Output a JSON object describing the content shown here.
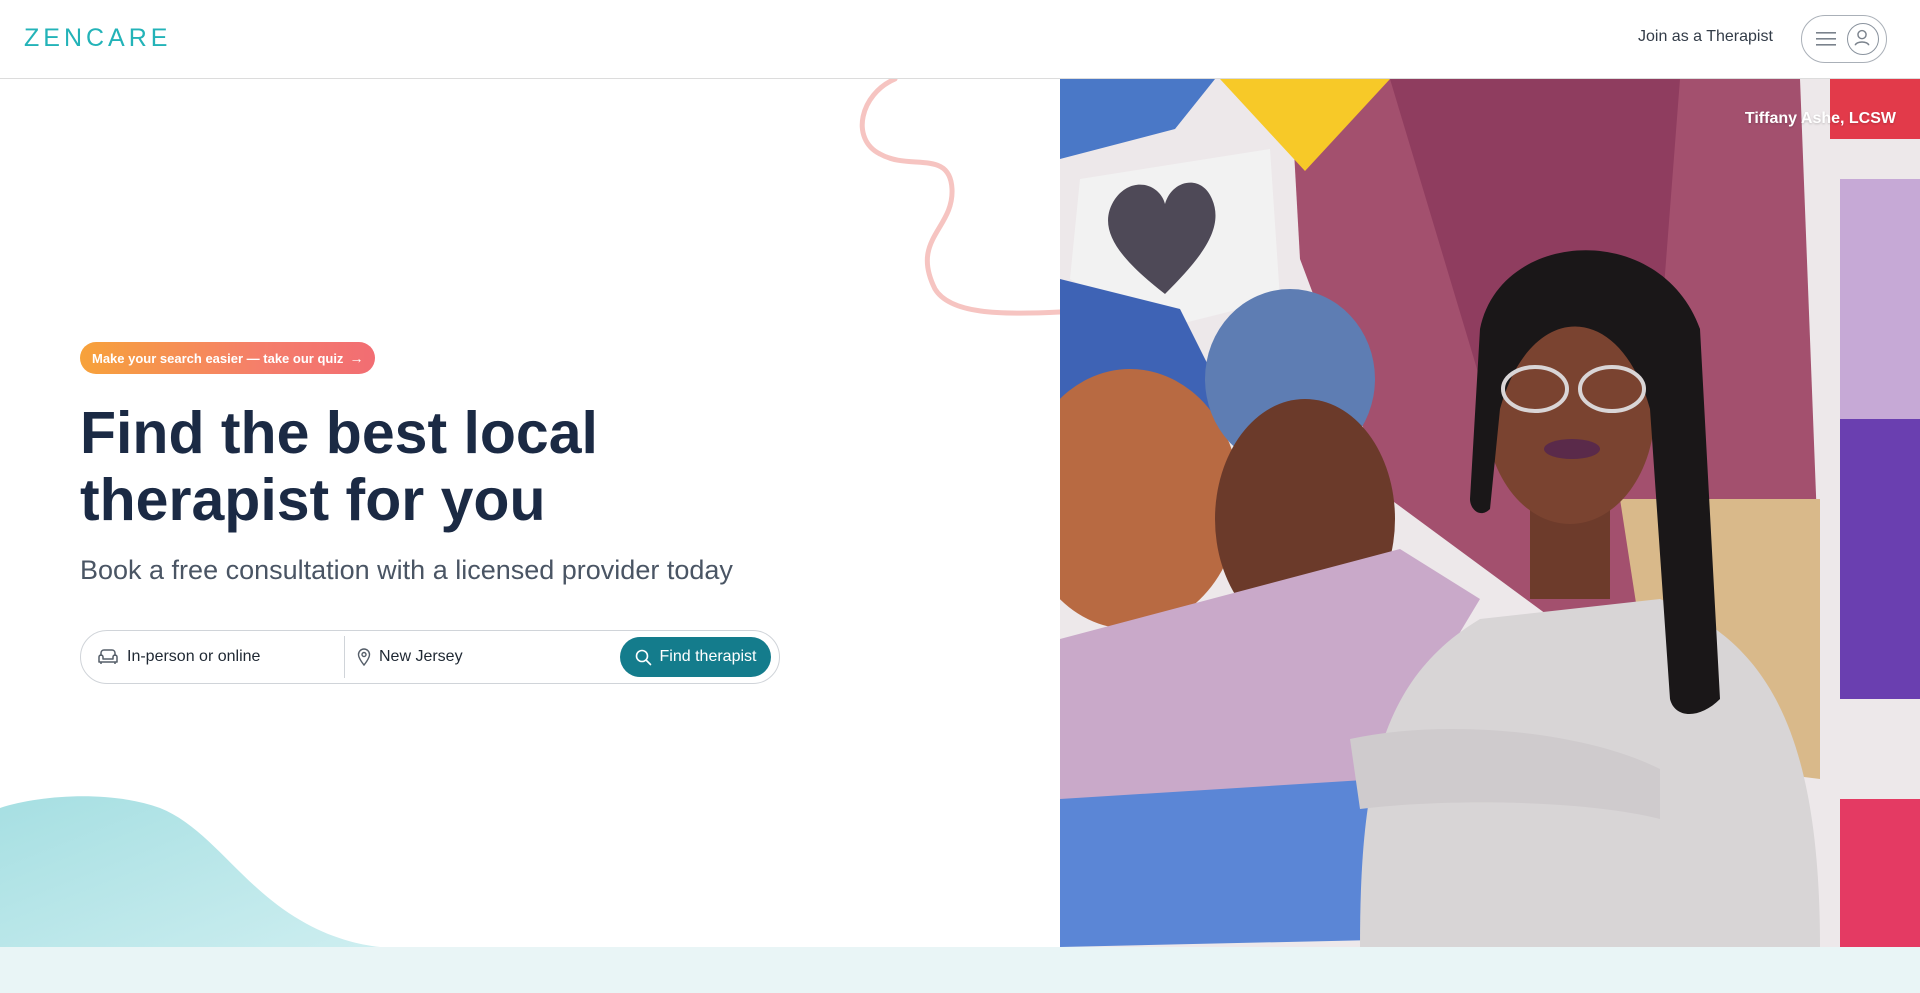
{
  "header": {
    "logo": "ZENCARE",
    "join_link": "Join as a Therapist"
  },
  "hero": {
    "quiz_label": "Make your search easier — take our quiz",
    "headline": "Find the best local therapist for you",
    "subhead": "Book a free consultation with a licensed provider today"
  },
  "search": {
    "mode_value": "In-person or online",
    "location_value": "New Jersey",
    "button_label": "Find therapist"
  },
  "photo": {
    "credit": "Tiffany Ashe, LCSW"
  },
  "colors": {
    "brand": "#23b3b8",
    "button": "#147c8c",
    "headline": "#1b2a44",
    "quiz_gradient_start": "#f7a23a",
    "quiz_gradient_end": "#f26d73"
  },
  "icons": {
    "menu": "hamburger-icon",
    "account": "user-icon",
    "mode": "couch-icon",
    "location": "map-pin-icon",
    "search": "search-icon",
    "quiz_arrow": "arrow-right-icon"
  }
}
